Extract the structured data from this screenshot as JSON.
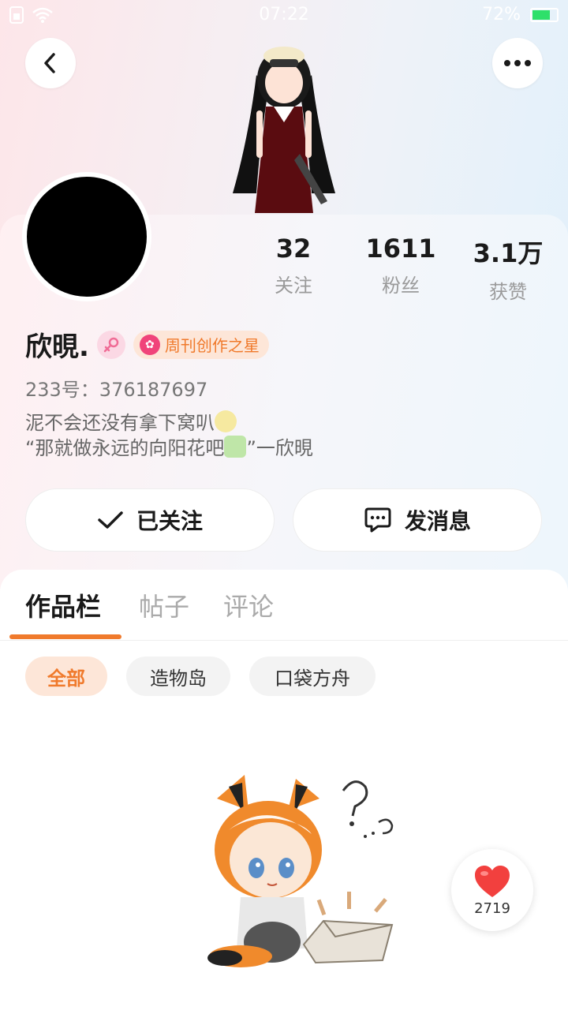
{
  "status_bar": {
    "time": "07:22",
    "battery": "72%"
  },
  "profile": {
    "name": "欣晛.",
    "badge": "周刊创作之星",
    "uid": "233号：376187697",
    "bio_line1": "泥不会还没有拿下窝叭",
    "bio_line2_a": "“那就做永远的向阳花吧",
    "bio_line2_b": "”一欣晛"
  },
  "stats": [
    {
      "value": "32",
      "label": "关注"
    },
    {
      "value": "1611",
      "label": "粉丝"
    },
    {
      "value": "3.1万",
      "label": "获赞"
    }
  ],
  "actions": {
    "follow": "已关注",
    "message": "发消息"
  },
  "tabs": [
    "作品栏",
    "帖子",
    "评论"
  ],
  "filters": [
    "全部",
    "造物岛",
    "口袋方舟"
  ],
  "like_fab": {
    "count": "2719"
  },
  "colors": {
    "accent": "#f07a2c",
    "badge_bg": "#fde6d8"
  }
}
